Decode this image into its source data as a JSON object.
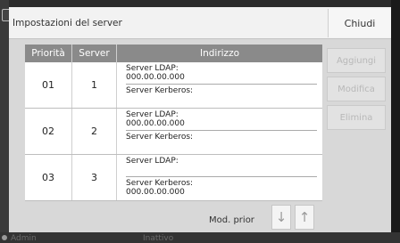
{
  "dialog": {
    "title": "Impostazioni del server",
    "close_label": "Chiudi"
  },
  "table": {
    "headers": {
      "priority": "Priorità",
      "server": "Server",
      "address": "Indirizzo"
    },
    "rows": [
      {
        "priority": "01",
        "server": "1",
        "ldap_label": "Server LDAP:",
        "ldap_value": "000.00.00.000",
        "kerberos_label": "Server Kerberos:",
        "kerberos_value": ""
      },
      {
        "priority": "02",
        "server": "2",
        "ldap_label": "Server LDAP:",
        "ldap_value": "000.00.00.000",
        "kerberos_label": "Server Kerberos:",
        "kerberos_value": ""
      },
      {
        "priority": "03",
        "server": "3",
        "ldap_label": "Server LDAP:",
        "ldap_value": "",
        "kerberos_label": "Server Kerberos:",
        "kerberos_value": "000.00.00.000"
      }
    ]
  },
  "actions": {
    "add": "Aggiungi",
    "edit": "Modifica",
    "delete": "Elimina"
  },
  "priority_control": {
    "label": "Mod. prior",
    "down_icon": "arrow-down-icon",
    "up_icon": "arrow-up-icon",
    "down_glyph": "↓",
    "up_glyph": "↑"
  },
  "background": {
    "left_text": "Admin",
    "center_text": "Inattivo"
  }
}
